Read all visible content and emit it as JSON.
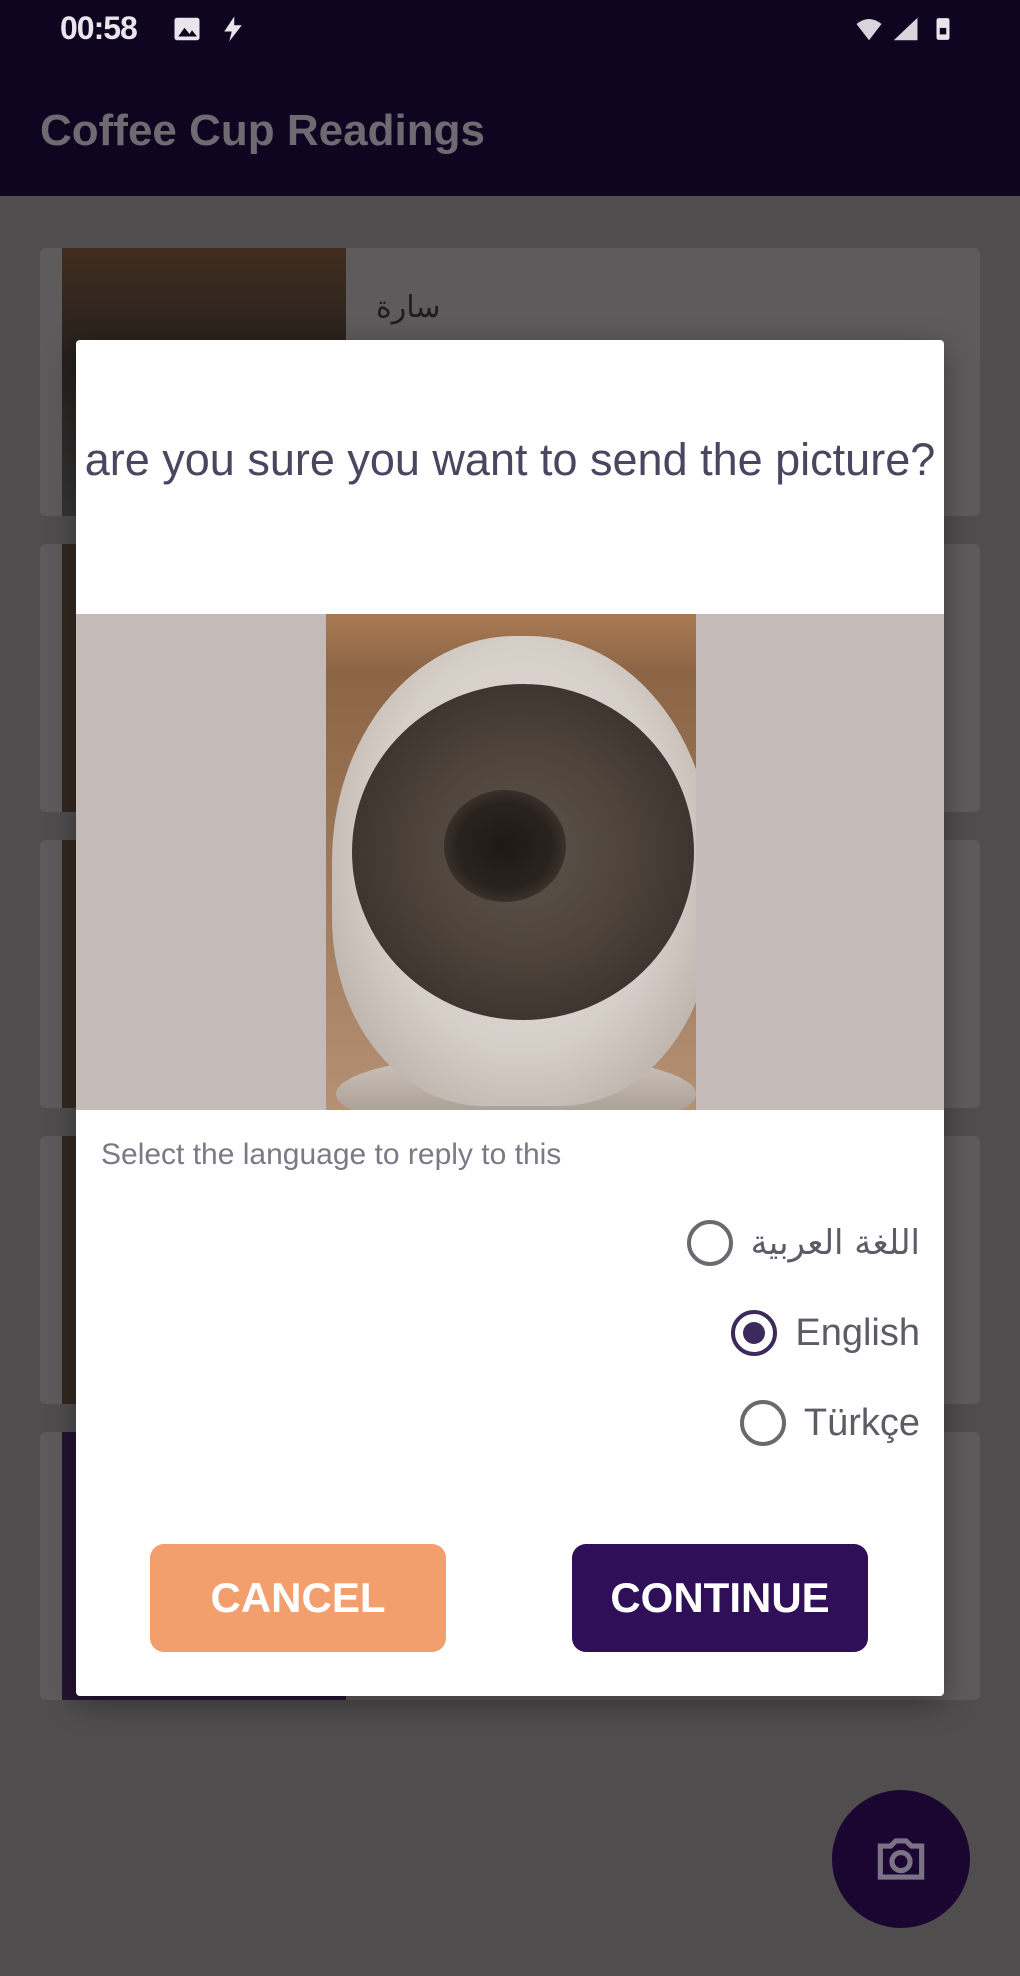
{
  "status_bar": {
    "time": "00:58",
    "icons": [
      "image-icon",
      "bolt-icon",
      "wifi-icon",
      "signal-icon",
      "battery-lock-icon"
    ]
  },
  "app_bar": {
    "title": "Coffee Cup Readings"
  },
  "list": {
    "items": [
      {
        "name": "سارة"
      }
    ]
  },
  "dialog": {
    "title": "are you sure you want to send the picture?",
    "photo_icon": "coffee-cup-photo",
    "language_prompt": "Select the language to reply to this",
    "options": [
      {
        "label": "اللغة العربية",
        "selected": false
      },
      {
        "label": "English",
        "selected": true
      },
      {
        "label": "Türkçe",
        "selected": false
      }
    ],
    "cancel_label": "CANCEL",
    "continue_label": "CONTINUE"
  },
  "fab": {
    "icon": "camera-switch-icon"
  },
  "colors": {
    "app_bar": "#100521",
    "cancel": "#f29e6d",
    "continue": "#2e0f58",
    "radio_selected": "#3c2a5a"
  }
}
